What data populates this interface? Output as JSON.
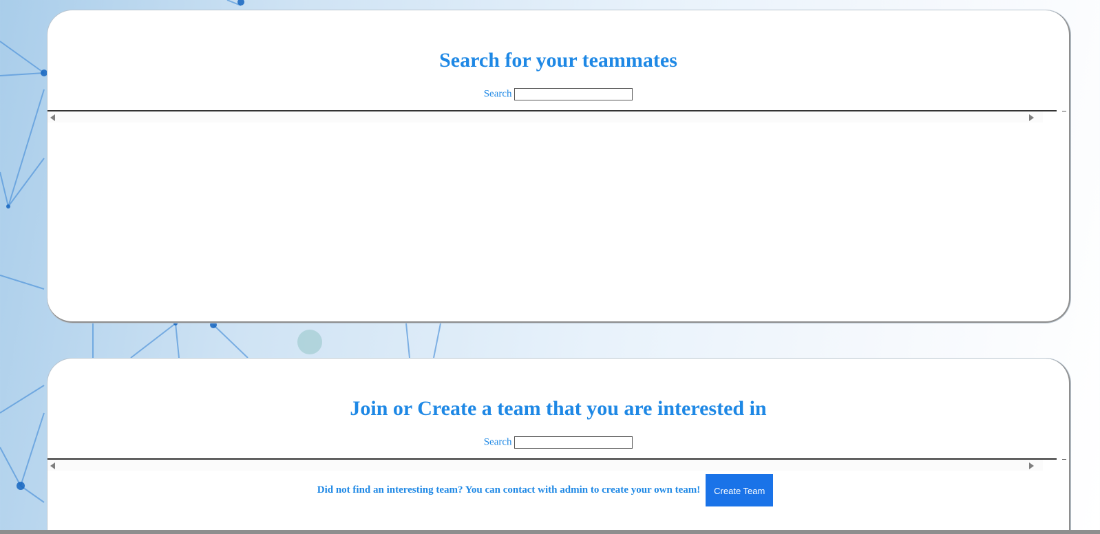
{
  "section_teammates": {
    "title": "Search for your teammates",
    "search_label": "Search",
    "search_value": "",
    "search_placeholder": ""
  },
  "section_teams": {
    "title": "Join or Create a team that you are interested in",
    "search_label": "Search",
    "search_value": "",
    "search_placeholder": "",
    "create_prompt": "Did not find an interesting team? You can contact with admin to create your own team!",
    "create_button_label": "Create Team"
  },
  "colors": {
    "accent": "#1e88e5",
    "button": "#1a73e8"
  }
}
